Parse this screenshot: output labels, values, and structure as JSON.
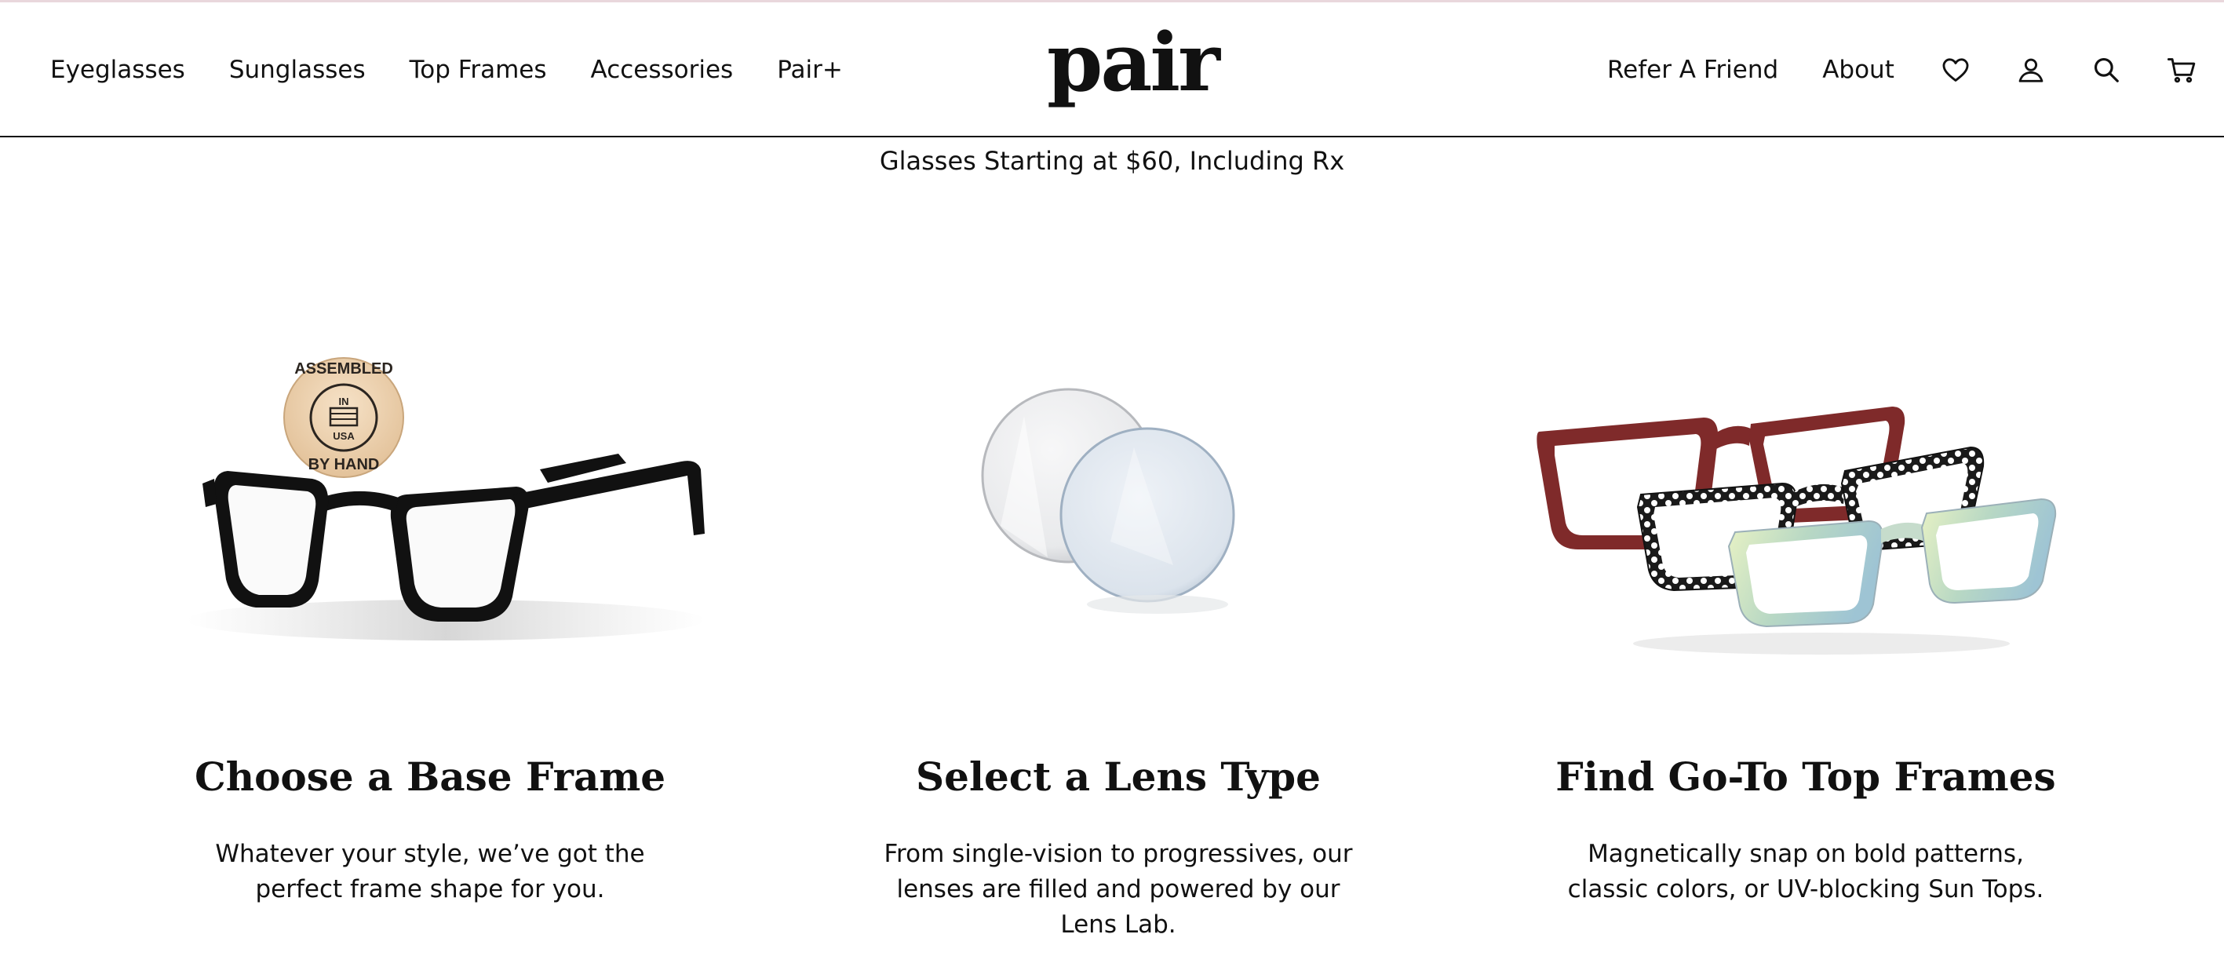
{
  "header": {
    "nav_left": [
      "Eyeglasses",
      "Sunglasses",
      "Top Frames",
      "Accessories",
      "Pair+"
    ],
    "logo": "pair",
    "nav_right": [
      "Refer A Friend",
      "About"
    ],
    "icons": [
      "heart-icon",
      "account-icon",
      "search-icon",
      "cart-icon"
    ]
  },
  "promo": "Glasses Starting at $60, Including Rx",
  "features": [
    {
      "title": "Choose a Base Frame",
      "description": "Whatever your style, we’ve got the perfect frame shape for you.",
      "badge": {
        "top": "ASSEMBLED",
        "middle_top": "IN",
        "middle_bottom": "USA",
        "bottom": "BY HAND"
      }
    },
    {
      "title": "Select a Lens Type",
      "description": "From single-vision to progressives, our lenses are filled and powered by our Lens Lab."
    },
    {
      "title": "Find Go-To Top Frames",
      "description": "Magnetically snap on bold patterns, classic colors, or UV-blocking Sun Tops."
    }
  ],
  "colors": {
    "accent_top_line": "#e9d7dc",
    "frame_red": "#7f2a2a",
    "frame_black": "#111111"
  }
}
